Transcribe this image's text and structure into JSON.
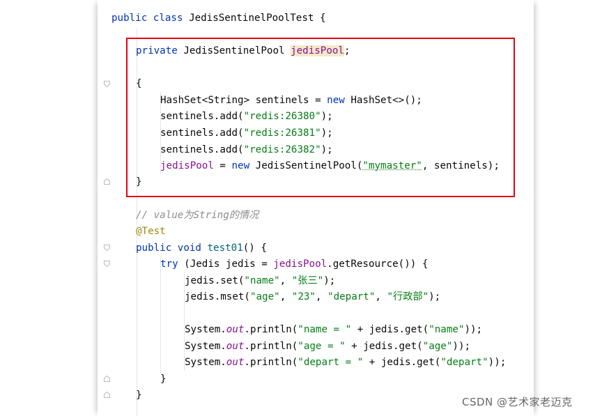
{
  "code": {
    "line_class": {
      "kw_public": "public",
      "kw_class": "class",
      "name": "JedisSentinelPoolTest",
      "brace": " {"
    },
    "line_field": {
      "kw_private": "private",
      "type": " JedisSentinelPool ",
      "var": "jedisPool",
      "semi": ";"
    },
    "line_open": "{",
    "line_set": {
      "pre": "HashSet<String> sentinels = ",
      "kw_new": "new",
      "post": " HashSet<>();"
    },
    "line_add1": {
      "pre": "sentinels.add(",
      "str": "\"redis:26380\"",
      "post": ");"
    },
    "line_add2": {
      "pre": "sentinels.add(",
      "str": "\"redis:26381\"",
      "post": ");"
    },
    "line_add3": {
      "pre": "sentinels.add(",
      "str": "\"redis:26382\"",
      "post": ");"
    },
    "line_pool": {
      "var": "jedisPool",
      "mid": " = ",
      "kw_new": "new",
      "ctor": " JedisSentinelPool(",
      "str": "\"mymaster\"",
      "post": ", sentinels);"
    },
    "line_close": "}",
    "line_comment": "// value为String的情况",
    "line_anno": "@Test",
    "line_method": {
      "kw_public": "public",
      "kw_void": " void ",
      "name": "test01",
      "post": "() {"
    },
    "line_try": {
      "kw_try": "try",
      "pre": " (Jedis jedis = ",
      "var": "jedisPool",
      "post": ".getResource()) {"
    },
    "line_set_name": {
      "pre": "jedis.set(",
      "s1": "\"name\"",
      "mid": ", ",
      "s2": "\"张三\"",
      "post": ");"
    },
    "line_mset": {
      "pre": "jedis.mset(",
      "s1": "\"age\"",
      "c1": ", ",
      "s2": "\"23\"",
      "c2": ", ",
      "s3": "\"depart\"",
      "c3": ", ",
      "s4": "\"行政部\"",
      "post": ");"
    },
    "line_print1": {
      "pre": "System.",
      "out": "out",
      "mid": ".println(",
      "s1": "\"name = \"",
      "mid2": " + jedis.get(",
      "s2": "\"name\"",
      "post": "));"
    },
    "line_print2": {
      "pre": "System.",
      "out": "out",
      "mid": ".println(",
      "s1": "\"age = \"",
      "mid2": " + jedis.get(",
      "s2": "\"age\"",
      "post": "));"
    },
    "line_print3": {
      "pre": "System.",
      "out": "out",
      "mid": ".println(",
      "s1": "\"depart = \"",
      "mid2": " + jedis.get(",
      "s2": "\"depart\"",
      "post": "));"
    },
    "line_close_try": "}",
    "line_close_method": "}"
  },
  "watermark": "CSDN @艺术家老迈克",
  "colors": {
    "keyword": "#0033b3",
    "string": "#067d17",
    "field": "#871094",
    "comment": "#8c8c8c",
    "annotation": "#9e880d",
    "highlight_border": "#e60012"
  }
}
